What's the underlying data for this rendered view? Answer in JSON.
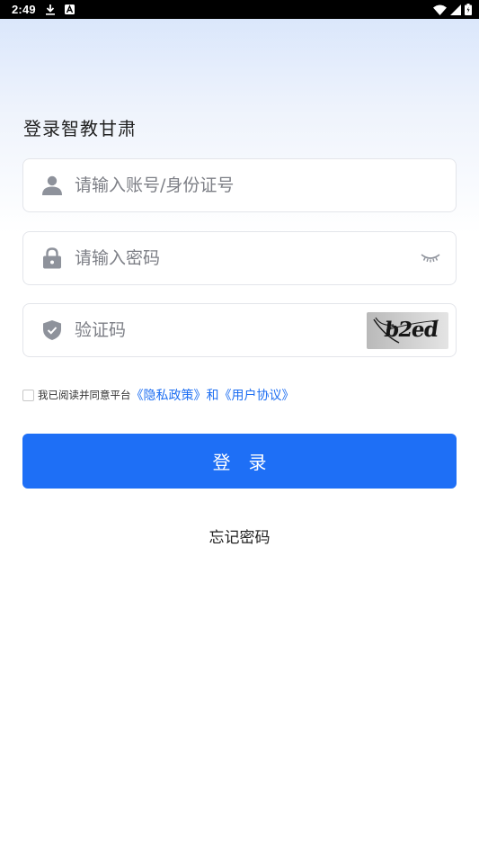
{
  "status_bar": {
    "time": "2:49",
    "left_icons": [
      "download-icon",
      "accessibility-a-icon"
    ],
    "right_icons": [
      "wifi-icon",
      "signal-icon",
      "battery-icon"
    ]
  },
  "page": {
    "title": "登录智教甘肃"
  },
  "account_field": {
    "placeholder": "请输入账号/身份证号",
    "value": "",
    "icon": "user-icon"
  },
  "password_field": {
    "placeholder": "请输入密码",
    "value": "",
    "icon": "lock-icon",
    "toggle_icon": "eye-closed-icon"
  },
  "captcha_field": {
    "placeholder": "验证码",
    "value": "",
    "icon": "shield-check-icon",
    "captcha_text": "b2ed"
  },
  "agreement": {
    "checked": false,
    "prefix": "我已阅读并同意平台",
    "privacy_link": "《隐私政策》",
    "conjunction": "和",
    "user_agreement_link": "《用户协议》"
  },
  "login_button": {
    "label": "登录"
  },
  "forgot_password": {
    "label": "忘记密码"
  },
  "colors": {
    "primary": "#1e6ff6",
    "link": "#1d6ef2",
    "icon_gray": "#8e929b"
  }
}
